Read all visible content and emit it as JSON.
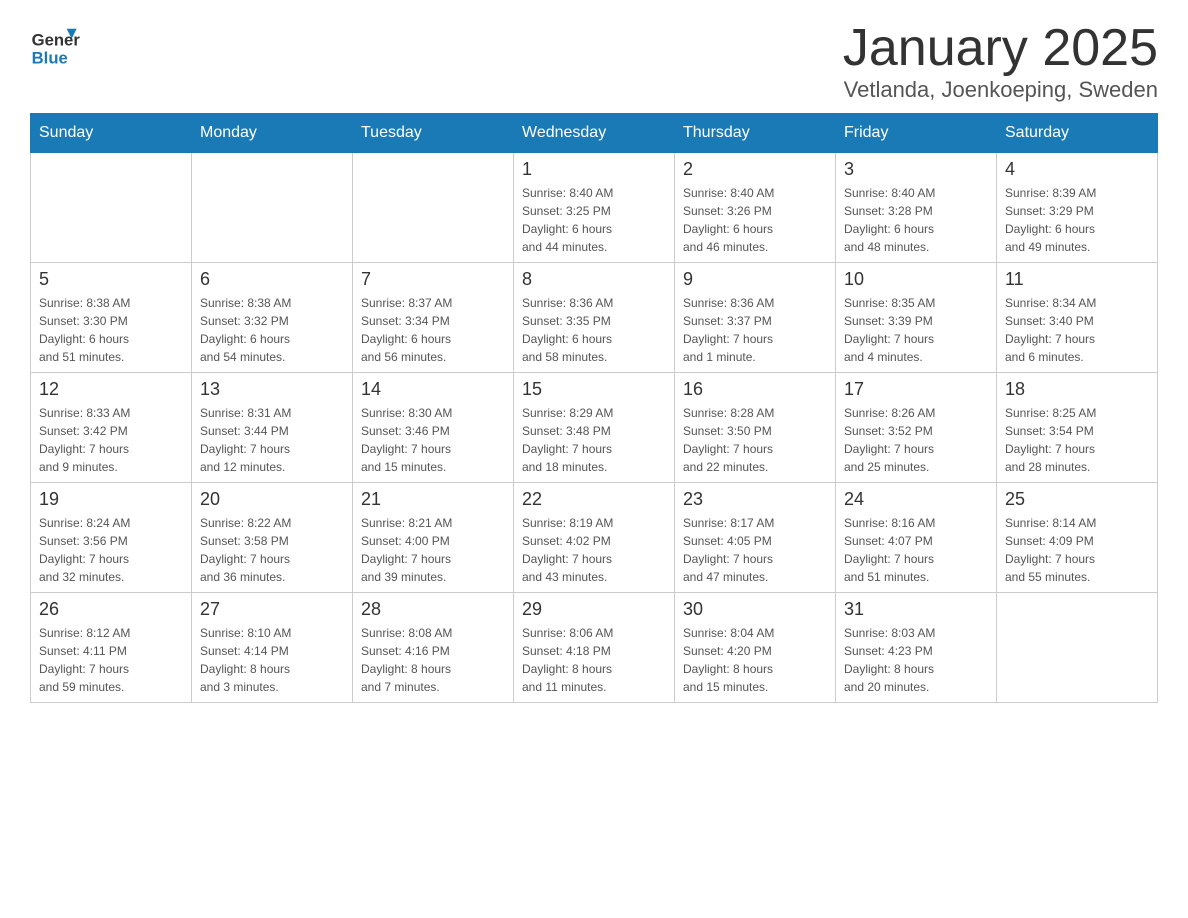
{
  "header": {
    "month_year": "January 2025",
    "location": "Vetlanda, Joenkoeping, Sweden",
    "logo_general": "General",
    "logo_blue": "Blue"
  },
  "weekdays": [
    "Sunday",
    "Monday",
    "Tuesday",
    "Wednesday",
    "Thursday",
    "Friday",
    "Saturday"
  ],
  "weeks": [
    [
      {
        "day": "",
        "info": ""
      },
      {
        "day": "",
        "info": ""
      },
      {
        "day": "",
        "info": ""
      },
      {
        "day": "1",
        "info": "Sunrise: 8:40 AM\nSunset: 3:25 PM\nDaylight: 6 hours\nand 44 minutes."
      },
      {
        "day": "2",
        "info": "Sunrise: 8:40 AM\nSunset: 3:26 PM\nDaylight: 6 hours\nand 46 minutes."
      },
      {
        "day": "3",
        "info": "Sunrise: 8:40 AM\nSunset: 3:28 PM\nDaylight: 6 hours\nand 48 minutes."
      },
      {
        "day": "4",
        "info": "Sunrise: 8:39 AM\nSunset: 3:29 PM\nDaylight: 6 hours\nand 49 minutes."
      }
    ],
    [
      {
        "day": "5",
        "info": "Sunrise: 8:38 AM\nSunset: 3:30 PM\nDaylight: 6 hours\nand 51 minutes."
      },
      {
        "day": "6",
        "info": "Sunrise: 8:38 AM\nSunset: 3:32 PM\nDaylight: 6 hours\nand 54 minutes."
      },
      {
        "day": "7",
        "info": "Sunrise: 8:37 AM\nSunset: 3:34 PM\nDaylight: 6 hours\nand 56 minutes."
      },
      {
        "day": "8",
        "info": "Sunrise: 8:36 AM\nSunset: 3:35 PM\nDaylight: 6 hours\nand 58 minutes."
      },
      {
        "day": "9",
        "info": "Sunrise: 8:36 AM\nSunset: 3:37 PM\nDaylight: 7 hours\nand 1 minute."
      },
      {
        "day": "10",
        "info": "Sunrise: 8:35 AM\nSunset: 3:39 PM\nDaylight: 7 hours\nand 4 minutes."
      },
      {
        "day": "11",
        "info": "Sunrise: 8:34 AM\nSunset: 3:40 PM\nDaylight: 7 hours\nand 6 minutes."
      }
    ],
    [
      {
        "day": "12",
        "info": "Sunrise: 8:33 AM\nSunset: 3:42 PM\nDaylight: 7 hours\nand 9 minutes."
      },
      {
        "day": "13",
        "info": "Sunrise: 8:31 AM\nSunset: 3:44 PM\nDaylight: 7 hours\nand 12 minutes."
      },
      {
        "day": "14",
        "info": "Sunrise: 8:30 AM\nSunset: 3:46 PM\nDaylight: 7 hours\nand 15 minutes."
      },
      {
        "day": "15",
        "info": "Sunrise: 8:29 AM\nSunset: 3:48 PM\nDaylight: 7 hours\nand 18 minutes."
      },
      {
        "day": "16",
        "info": "Sunrise: 8:28 AM\nSunset: 3:50 PM\nDaylight: 7 hours\nand 22 minutes."
      },
      {
        "day": "17",
        "info": "Sunrise: 8:26 AM\nSunset: 3:52 PM\nDaylight: 7 hours\nand 25 minutes."
      },
      {
        "day": "18",
        "info": "Sunrise: 8:25 AM\nSunset: 3:54 PM\nDaylight: 7 hours\nand 28 minutes."
      }
    ],
    [
      {
        "day": "19",
        "info": "Sunrise: 8:24 AM\nSunset: 3:56 PM\nDaylight: 7 hours\nand 32 minutes."
      },
      {
        "day": "20",
        "info": "Sunrise: 8:22 AM\nSunset: 3:58 PM\nDaylight: 7 hours\nand 36 minutes."
      },
      {
        "day": "21",
        "info": "Sunrise: 8:21 AM\nSunset: 4:00 PM\nDaylight: 7 hours\nand 39 minutes."
      },
      {
        "day": "22",
        "info": "Sunrise: 8:19 AM\nSunset: 4:02 PM\nDaylight: 7 hours\nand 43 minutes."
      },
      {
        "day": "23",
        "info": "Sunrise: 8:17 AM\nSunset: 4:05 PM\nDaylight: 7 hours\nand 47 minutes."
      },
      {
        "day": "24",
        "info": "Sunrise: 8:16 AM\nSunset: 4:07 PM\nDaylight: 7 hours\nand 51 minutes."
      },
      {
        "day": "25",
        "info": "Sunrise: 8:14 AM\nSunset: 4:09 PM\nDaylight: 7 hours\nand 55 minutes."
      }
    ],
    [
      {
        "day": "26",
        "info": "Sunrise: 8:12 AM\nSunset: 4:11 PM\nDaylight: 7 hours\nand 59 minutes."
      },
      {
        "day": "27",
        "info": "Sunrise: 8:10 AM\nSunset: 4:14 PM\nDaylight: 8 hours\nand 3 minutes."
      },
      {
        "day": "28",
        "info": "Sunrise: 8:08 AM\nSunset: 4:16 PM\nDaylight: 8 hours\nand 7 minutes."
      },
      {
        "day": "29",
        "info": "Sunrise: 8:06 AM\nSunset: 4:18 PM\nDaylight: 8 hours\nand 11 minutes."
      },
      {
        "day": "30",
        "info": "Sunrise: 8:04 AM\nSunset: 4:20 PM\nDaylight: 8 hours\nand 15 minutes."
      },
      {
        "day": "31",
        "info": "Sunrise: 8:03 AM\nSunset: 4:23 PM\nDaylight: 8 hours\nand 20 minutes."
      },
      {
        "day": "",
        "info": ""
      }
    ]
  ]
}
